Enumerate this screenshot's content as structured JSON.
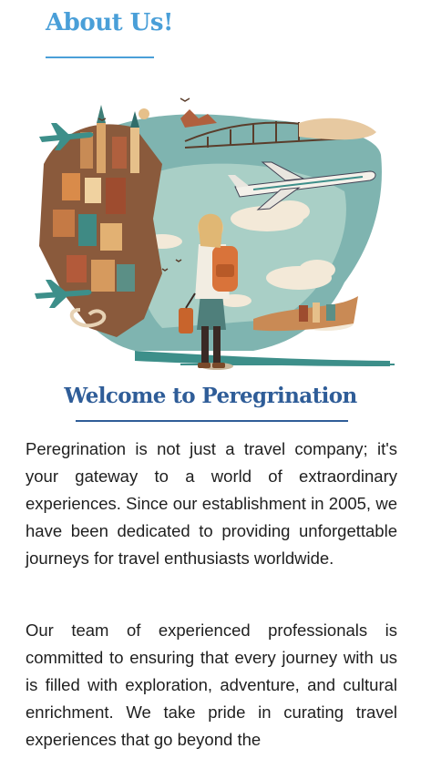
{
  "page": {
    "heading": "About Us!"
  },
  "hero": {
    "alt": "Illustration of a traveler with a backpack and suitcase looking toward a collage of cities, airplanes and clouds"
  },
  "welcome": {
    "title": "Welcome to Peregrination",
    "paragraphs": [
      "Peregrination is not just a travel company; it's your gateway to a world of extraordinary experiences. Since our establishment in 2005, we have been dedicated to providing unforgettable journeys for travel enthusiasts worldwide.",
      "Our team of experienced professionals is committed to ensuring that every journey with us is filled with exploration, adventure, and cultural enrichment. We take pride in curating travel experiences that go beyond the"
    ]
  },
  "colors": {
    "heading": "#4a9fd8",
    "title": "#2f5d98",
    "text": "#1f1f1f"
  }
}
